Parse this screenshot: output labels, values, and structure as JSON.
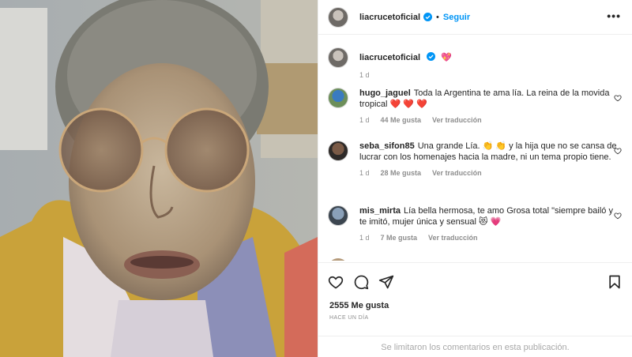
{
  "header": {
    "username": "liacrucetoficial",
    "separator": "•",
    "follow_label": "Seguir",
    "more_label": "•••"
  },
  "caption": {
    "username": "liacrucetoficial",
    "emoji": "💖",
    "time": "1 d"
  },
  "comments": [
    {
      "username": "hugo_jaguel",
      "text": "Toda la Argentina te ama lía. La reina de la movida tropical ❤️ ❤️ ❤️",
      "time": "1 d",
      "likes": "44 Me gusta",
      "translate": "Ver traducción"
    },
    {
      "username": "seba_sifon85",
      "text": "Una grande Lía. 👏 👏 y la hija que no se cansa de lucrar con los homenajes hacia la madre, ni un tema propio tiene.",
      "time": "1 d",
      "likes": "28 Me gusta",
      "translate": "Ver traducción"
    },
    {
      "username": "mis_mirta",
      "text": "Lía bella hermosa, te amo Grosa total \"siempre bailó y te imitó, mujer única y sensual 😻 💗",
      "time": "1 d",
      "likes": "7 Me gusta",
      "translate": "Ver traducción"
    }
  ],
  "actions": {
    "likes_count": "2555 Me gusta",
    "time_ago": "HACE UN DÍA",
    "comments_disabled": "Se limitaron los comentarios en esta publicación."
  },
  "colors": {
    "accent": "#0095f6",
    "verified": "#0095f6",
    "heart": "#ed4956",
    "muted": "#8e8e8e"
  },
  "icons": [
    "verified-badge-icon",
    "heart-icon",
    "comment-icon",
    "share-icon",
    "bookmark-icon",
    "more-icon"
  ]
}
